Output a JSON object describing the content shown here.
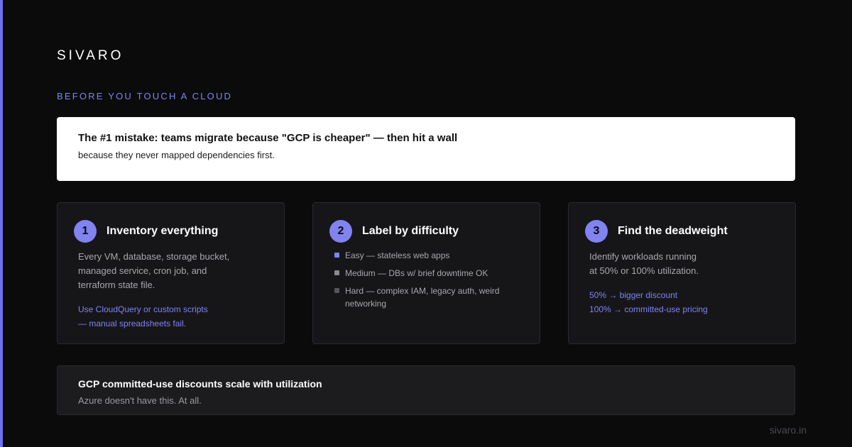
{
  "brand": "SIVARO",
  "eyebrow": "BEFORE YOU TOUCH A CLOUD",
  "callout": {
    "title": "The #1 mistake: teams migrate because \"GCP is cheaper\" — then hit a wall",
    "subtitle": "because they never mapped dependencies first."
  },
  "cards": [
    {
      "number": "1",
      "title": "Inventory everything",
      "body": [
        "Every VM, database, storage bucket,",
        "managed service, cron job, and",
        "terraform state file."
      ],
      "link": [
        "Use CloudQuery or custom scripts",
        "— manual spreadsheets fail."
      ]
    },
    {
      "number": "2",
      "title": "Label by difficulty",
      "items": [
        {
          "text": "Easy — stateless web apps",
          "color": "#8083f0"
        },
        {
          "text": "Medium — DBs w/ brief downtime OK",
          "color": "#8a8a90"
        },
        {
          "text": "Hard — complex IAM, legacy auth, weird networking",
          "color": "#55555b"
        }
      ]
    },
    {
      "number": "3",
      "title": "Find the deadweight",
      "body": [
        "Identify workloads running",
        "at 50% or 100% utilization."
      ],
      "link": [
        "50% → bigger discount",
        "100% → committed-use pricing"
      ]
    }
  ],
  "note": {
    "title": "GCP committed-use discounts scale with utilization",
    "subtitle": "Azure doesn't have this. At all."
  },
  "footer": "sivaro.in",
  "colors": {
    "accent": "#6f72f0",
    "badge": "#8083f0",
    "background": "#0b0b0c",
    "card": "#161619"
  }
}
